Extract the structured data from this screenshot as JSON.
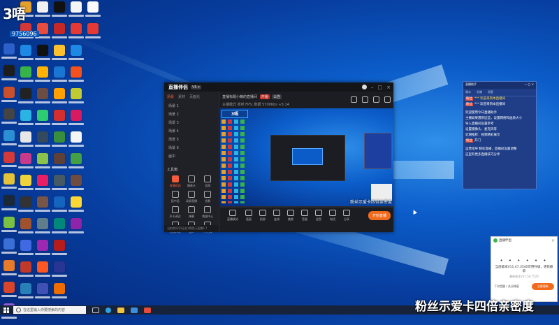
{
  "desktop": {
    "badge_text": "3唔",
    "badge_number": "9756096"
  },
  "app": {
    "brand": "直播伴侣",
    "version": "V6 ▾",
    "tabs": [
      "场景",
      "素材",
      "页面光"
    ],
    "scenes": [
      "场景 1",
      "场景 2",
      "场景 3",
      "场景 4",
      "场景 5",
      "场景 6",
      "画中"
    ],
    "tools_title": "工具箱",
    "tools": [
      "直播画面",
      "摄像头",
      "投屏",
      "画中画",
      "录屏直播",
      "投影",
      "声卡调试",
      "弹幕",
      "数据中心",
      "礼物特效",
      "变声",
      "小工具"
    ],
    "left_footer": "当前房间号(还在)将提示直播6.7",
    "info_title": "直播标题小薇的直播间",
    "info_tags": [
      "开播",
      "公告"
    ],
    "info_line2": "主播模式  收听  FPS:  数据  5700Kbs  ≈5:14",
    "controls": [
      "直播模式",
      "画面",
      "投屏",
      "连线",
      "美颜",
      "音量",
      "混音",
      "电话",
      "分享"
    ],
    "start_button": "开始直播",
    "preview_caption": "粉丝示爱卡四倍亲密度",
    "preview_title": "3唔"
  },
  "chat": {
    "header": "直播助手",
    "header_right": "— □ ×",
    "sub": [
      "观众",
      "礼物",
      "消息"
    ],
    "lines": [
      {
        "tag": "粉丝",
        "text": "*** 欢迎来到本直播间"
      },
      {
        "tag": "粉丝",
        "text": "*** 欢迎来到本直播间"
      },
      {
        "tag": "",
        "text": "欢迎使用今日直播助手"
      },
      {
        "tag": "",
        "text": "主播如果遇到这些，设置网络和画质大小"
      },
      {
        "tag": "",
        "text": "导入直播间设置参考"
      },
      {
        "tag": "",
        "text": "设置摄像头、麦克风等"
      },
      {
        "tag": "",
        "text": "近期推荐：视频精彩展示"
      },
      {
        "tag": "粉丝",
        "text": "开门"
      },
      {
        "tag": "",
        "text": "运营指导 精彩直播，直播间设置调整"
      },
      {
        "tag": "",
        "text": "这里有更多直播技巧分享"
      }
    ]
  },
  "notification": {
    "title": "直播伴侣",
    "dots": "• • • • • •",
    "message": "当前版本V11.47.3540可用升级，更新最新",
    "sub": "最新版本V11.50.7520",
    "fine": "下次提醒 / 关闭弹窗",
    "confirm": "立即更新"
  },
  "taskbar": {
    "search_placeholder": "在这里输入你要搜索的内容"
  },
  "overlay_caption": "粉丝示爱卡四倍亲密度"
}
